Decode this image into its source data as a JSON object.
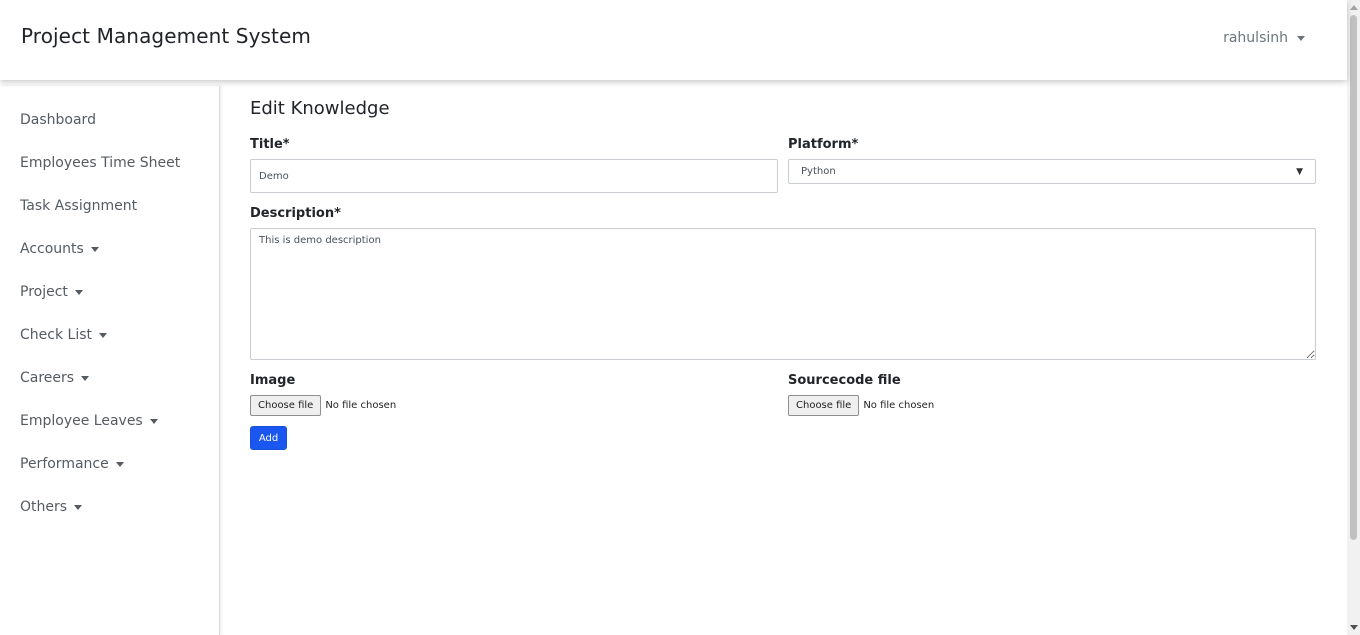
{
  "header": {
    "brand": "Project Management System",
    "user": "rahulsinh"
  },
  "sidebar": {
    "items": [
      {
        "label": "Dashboard",
        "dropdown": false
      },
      {
        "label": "Employees Time Sheet",
        "dropdown": false
      },
      {
        "label": "Task Assignment",
        "dropdown": false
      },
      {
        "label": "Accounts",
        "dropdown": true
      },
      {
        "label": "Project",
        "dropdown": true
      },
      {
        "label": "Check List",
        "dropdown": true
      },
      {
        "label": "Careers",
        "dropdown": true
      },
      {
        "label": "Employee Leaves",
        "dropdown": true
      },
      {
        "label": "Performance",
        "dropdown": true
      },
      {
        "label": "Others",
        "dropdown": true
      }
    ]
  },
  "form": {
    "page_title": "Edit Knowledge",
    "title_label": "Title*",
    "title_value": "Demo",
    "platform_label": "Platform*",
    "platform_value": "Python",
    "description_label": "Description*",
    "description_value": "This is demo description",
    "image_label": "Image",
    "sourcecode_label": "Sourcecode file",
    "choose_file_label": "Choose file",
    "no_file_label": "No file chosen",
    "add_label": "Add"
  },
  "colors": {
    "primary_button": "#1a56f0",
    "sidebar_text": "#555b61"
  }
}
